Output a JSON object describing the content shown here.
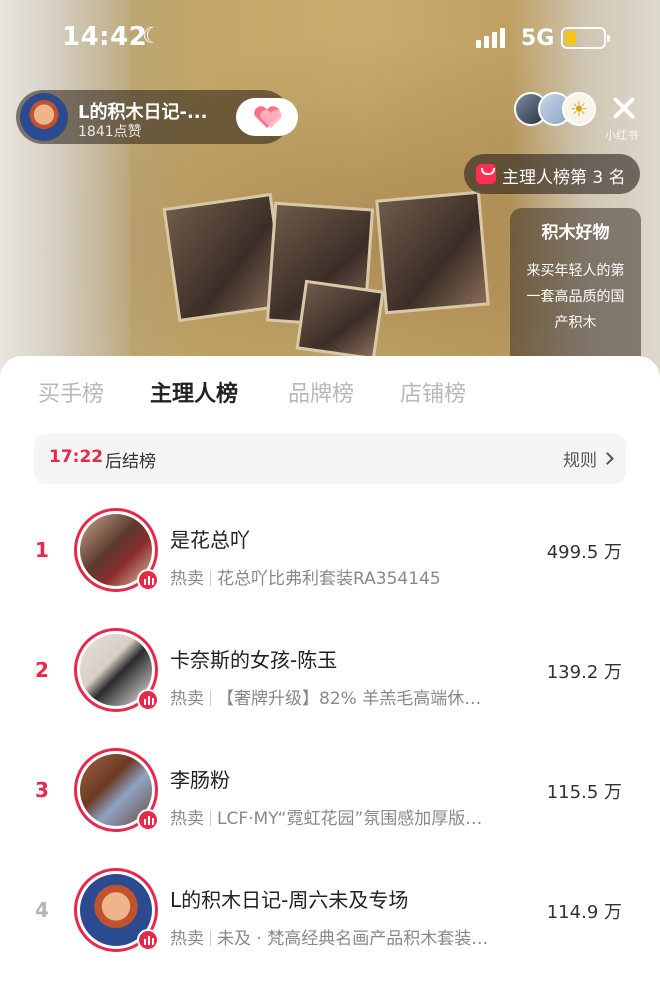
{
  "status_bar": {
    "time": "14:42",
    "network": "5G"
  },
  "host": {
    "name": "L的积木日记-...",
    "likes": "1841点赞"
  },
  "watermark": "小红书",
  "rank_badge": "主理人榜第 3 名",
  "promo": {
    "title": "积木好物",
    "lines": [
      "来买年轻人的第",
      "一套高品质的国",
      "产积木"
    ]
  },
  "tabs": [
    {
      "label": "买手榜",
      "active": false
    },
    {
      "label": "主理人榜",
      "active": true
    },
    {
      "label": "品牌榜",
      "active": false
    },
    {
      "label": "店铺榜",
      "active": false
    }
  ],
  "countdown": {
    "time": "17:22",
    "label": "后结榜",
    "rules": "规则"
  },
  "ranking": [
    {
      "rank": "1",
      "name": "是花总吖",
      "tag": "热卖",
      "desc": "花总吖比弗利套装RA354145",
      "score": "499.5 万",
      "rank_color": "#e8284b"
    },
    {
      "rank": "2",
      "name": "卡奈斯的女孩-陈玉",
      "tag": "热卖",
      "desc": "【奢牌升级】82% 羊羔毛高端休…",
      "score": "139.2 万",
      "rank_color": "#e8284b"
    },
    {
      "rank": "3",
      "name": "李肠粉",
      "tag": "热卖",
      "desc": "LCF·MY“霓虹花园”氛围感加厚版…",
      "score": "115.5 万",
      "rank_color": "#e8284b"
    },
    {
      "rank": "4",
      "name": "L的积木日记-周六未及专场",
      "tag": "热卖",
      "desc": "未及 · 梵高经典名画产品积木套装…",
      "score": "114.9 万",
      "rank_color": "#b5b5b5"
    }
  ],
  "colors": {
    "accent": "#e8284b"
  }
}
